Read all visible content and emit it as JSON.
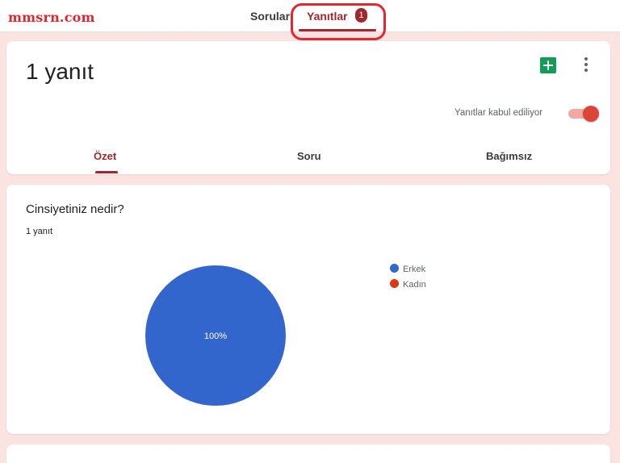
{
  "watermark": "mmsrn.com",
  "top_tabs": {
    "questions_label": "Sorular",
    "responses_label": "Yanıtlar",
    "responses_count": "1"
  },
  "summary_card": {
    "title": "1 yanıt",
    "sheets_icon": "google-sheets-icon",
    "more_icon": "more-vert-icon",
    "accepting_label": "Yanıtlar kabul ediliyor",
    "accepting_on": true,
    "tabs": [
      "Özet",
      "Soru",
      "Bağımsız"
    ],
    "active_tab": "Özet"
  },
  "question_card": {
    "title": "Cinsiyetiniz nedir?",
    "response_count": "1 yanıt"
  },
  "chart_data": {
    "type": "pie",
    "categories": [
      "Erkek",
      "Kadın"
    ],
    "values": [
      100,
      0
    ],
    "colors": [
      "#3366cc",
      "#dc3912"
    ],
    "slice_labels": [
      "100%",
      ""
    ],
    "legend_position": "right"
  },
  "colors": {
    "accent": "#a4262c",
    "background": "#fbe3e1",
    "annotation_red": "#e5262e"
  }
}
